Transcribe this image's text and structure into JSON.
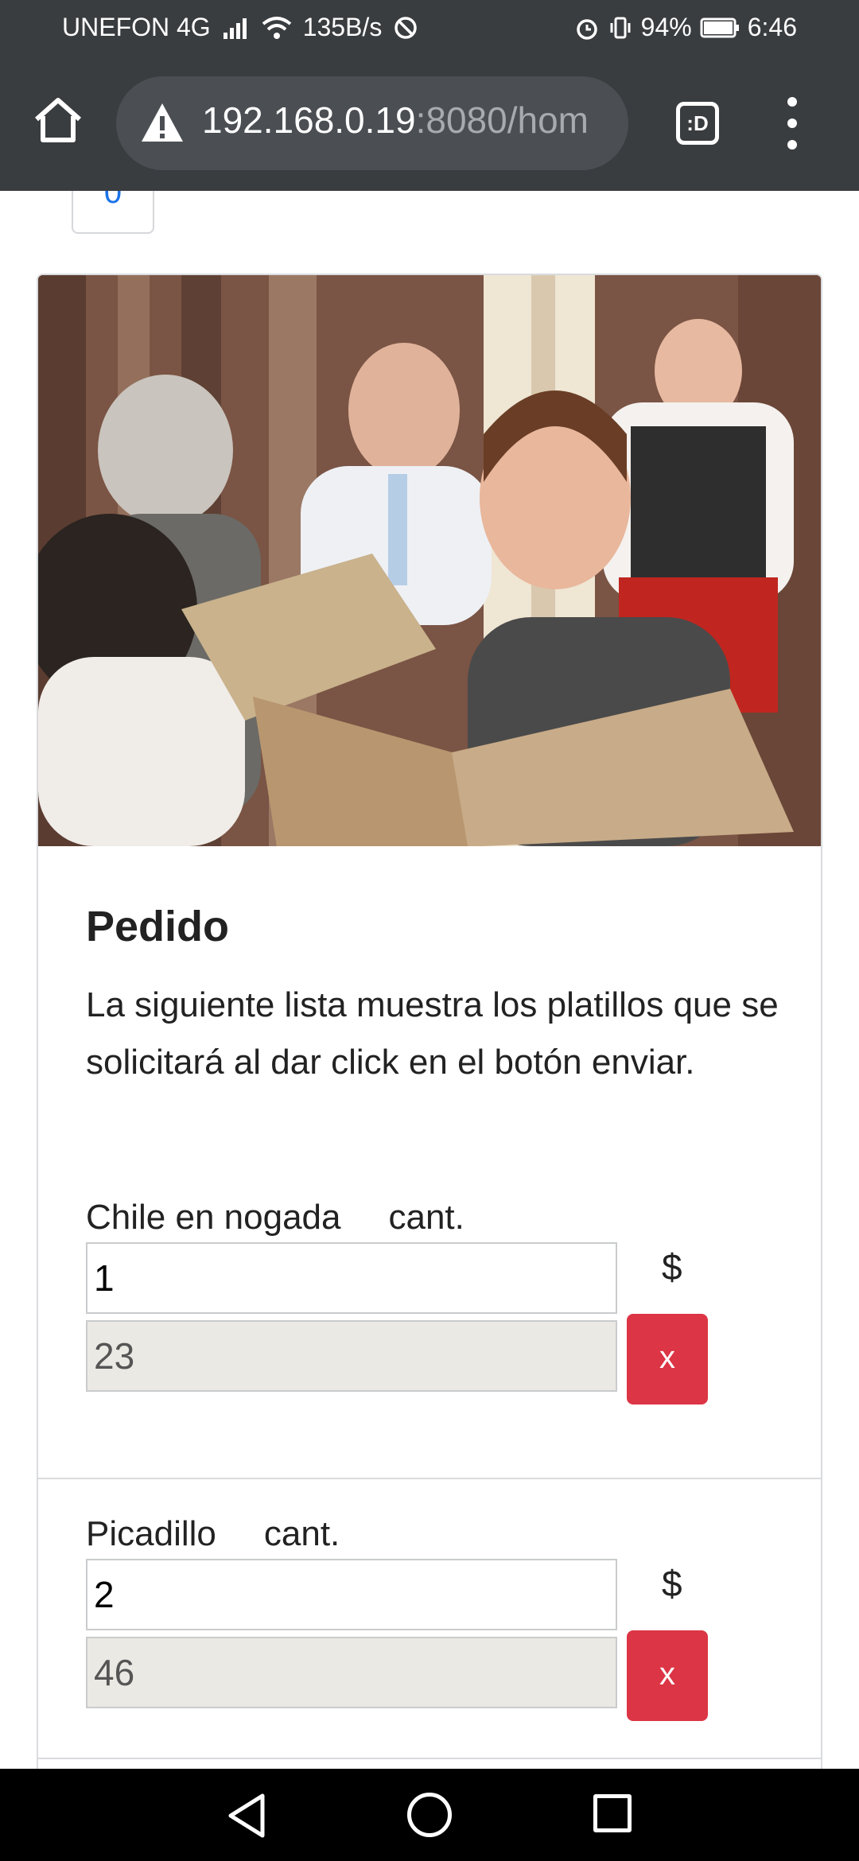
{
  "status_bar": {
    "carrier": "UNEFON 4G",
    "speed": "135B/s",
    "battery": "94%",
    "time": "6:46"
  },
  "browser": {
    "url_host": "192.168.0.19",
    "url_rest": ":8080/hom",
    "tab_button_label": ":D"
  },
  "prev_badge": "0",
  "card": {
    "title": "Pedido",
    "description": "La siguiente lista muestra los platillos que se solicitará al dar click en el botón enviar.",
    "items": [
      {
        "name": "Chile en nogada",
        "qty_label": "cant.",
        "qty": "1",
        "currency": "$",
        "price": "23",
        "remove": "x"
      },
      {
        "name": "Picadillo",
        "qty_label": "cant.",
        "qty": "2",
        "currency": "$",
        "price": "46",
        "remove": "x"
      }
    ]
  },
  "colors": {
    "chrome": "#3a3d40",
    "danger": "#dc3545",
    "readonly_bg": "#ebe9e4"
  }
}
